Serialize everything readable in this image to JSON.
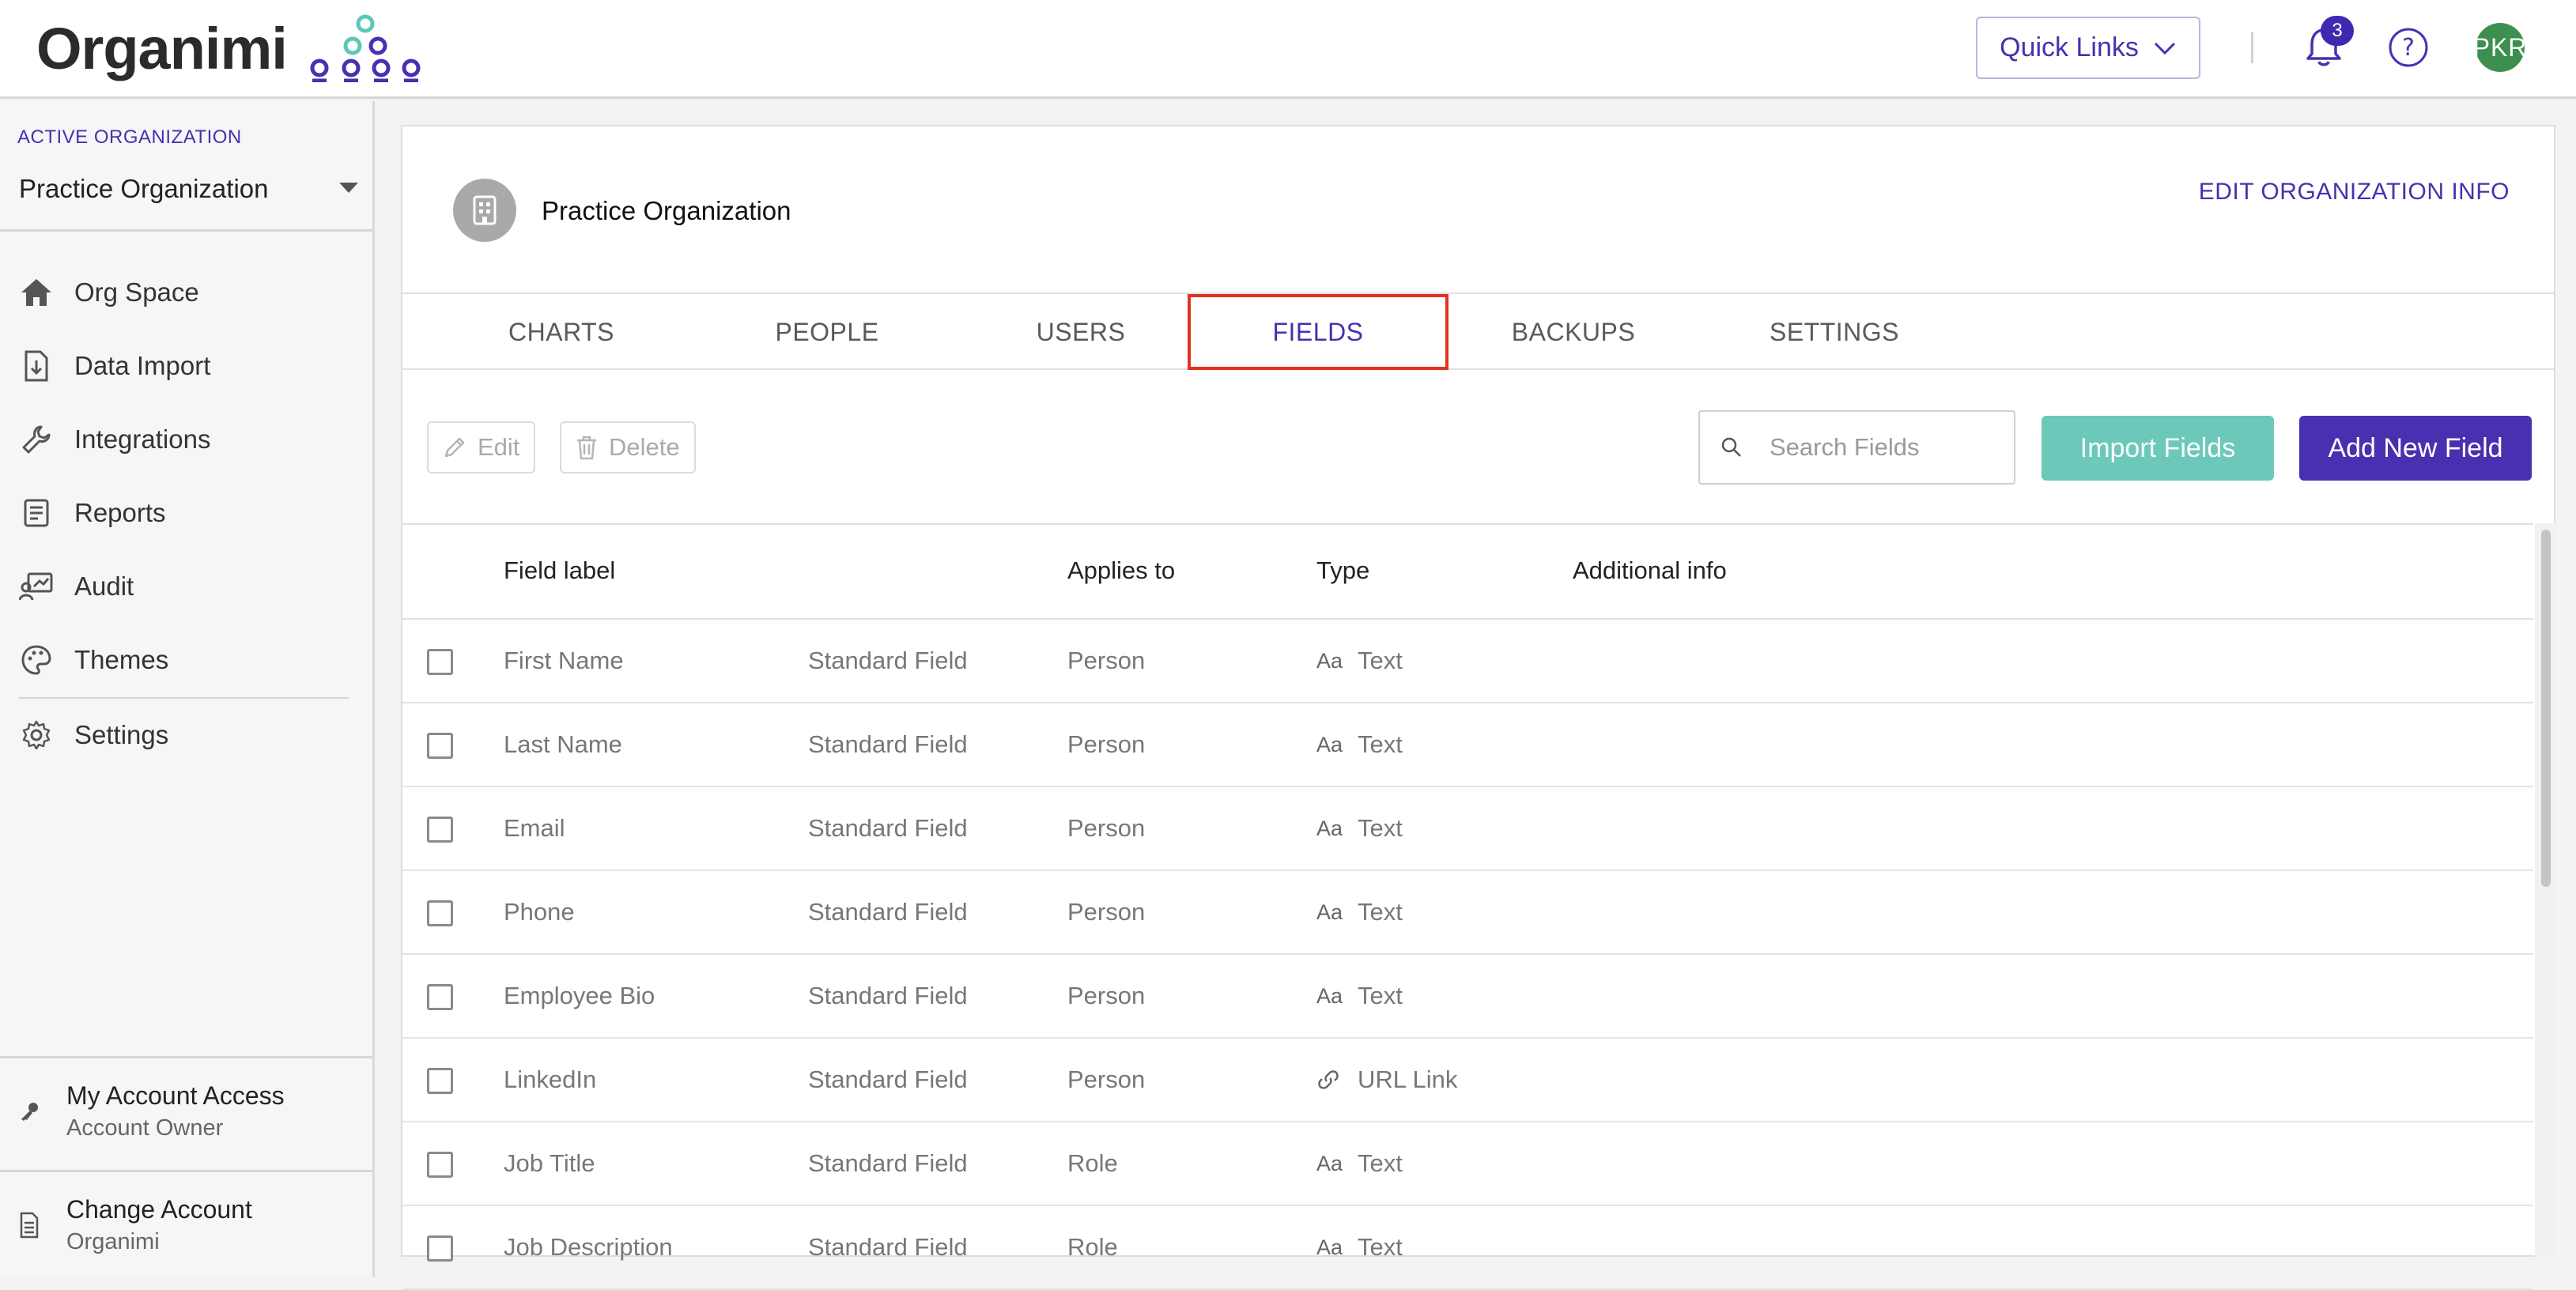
{
  "brand": {
    "name": "Organimi",
    "accent": "#4a2fb0",
    "teal": "#6cc9b9"
  },
  "topbar": {
    "quick_links_label": "Quick Links",
    "notification_count": "3",
    "avatar_initials": "PKR"
  },
  "sidebar": {
    "active_org_label": "ACTIVE ORGANIZATION",
    "active_org_value": "Practice Organization",
    "items": [
      {
        "label": "Org Space",
        "icon": "home-icon"
      },
      {
        "label": "Data Import",
        "icon": "import-icon"
      },
      {
        "label": "Integrations",
        "icon": "wrench-icon"
      },
      {
        "label": "Reports",
        "icon": "report-icon"
      },
      {
        "label": "Audit",
        "icon": "audit-icon"
      },
      {
        "label": "Themes",
        "icon": "palette-icon"
      },
      {
        "label": "Settings",
        "icon": "gear-icon"
      }
    ],
    "account_access": {
      "title": "My Account Access",
      "subtitle": "Account Owner"
    },
    "change_account": {
      "title": "Change Account",
      "subtitle": "Organimi"
    }
  },
  "main": {
    "org_name": "Practice Organization",
    "edit_org_label": "EDIT ORGANIZATION INFO",
    "tabs": [
      {
        "label": "CHARTS"
      },
      {
        "label": "PEOPLE"
      },
      {
        "label": "USERS"
      },
      {
        "label": "FIELDS",
        "active": true
      },
      {
        "label": "BACKUPS"
      },
      {
        "label": "SETTINGS"
      }
    ],
    "toolbar": {
      "edit_label": "Edit",
      "delete_label": "Delete",
      "search_placeholder": "Search Fields",
      "import_label": "Import Fields",
      "add_label": "Add New Field"
    },
    "table": {
      "headers": {
        "field_label": "Field label",
        "applies_to": "Applies to",
        "type": "Type",
        "additional_info": "Additional info"
      },
      "rows": [
        {
          "label": "First Name",
          "category": "Standard Field",
          "applies_to": "Person",
          "type_icon": "Aa",
          "type": "Text",
          "additional_info": ""
        },
        {
          "label": "Last Name",
          "category": "Standard Field",
          "applies_to": "Person",
          "type_icon": "Aa",
          "type": "Text",
          "additional_info": ""
        },
        {
          "label": "Email",
          "category": "Standard Field",
          "applies_to": "Person",
          "type_icon": "Aa",
          "type": "Text",
          "additional_info": ""
        },
        {
          "label": "Phone",
          "category": "Standard Field",
          "applies_to": "Person",
          "type_icon": "Aa",
          "type": "Text",
          "additional_info": ""
        },
        {
          "label": "Employee Bio",
          "category": "Standard Field",
          "applies_to": "Person",
          "type_icon": "Aa",
          "type": "Text",
          "additional_info": ""
        },
        {
          "label": "LinkedIn",
          "category": "Standard Field",
          "applies_to": "Person",
          "type_icon": "link",
          "type": "URL Link",
          "additional_info": ""
        },
        {
          "label": "Job Title",
          "category": "Standard Field",
          "applies_to": "Role",
          "type_icon": "Aa",
          "type": "Text",
          "additional_info": ""
        },
        {
          "label": "Job Description",
          "category": "Standard Field",
          "applies_to": "Role",
          "type_icon": "Aa",
          "type": "Text",
          "additional_info": ""
        }
      ]
    }
  }
}
